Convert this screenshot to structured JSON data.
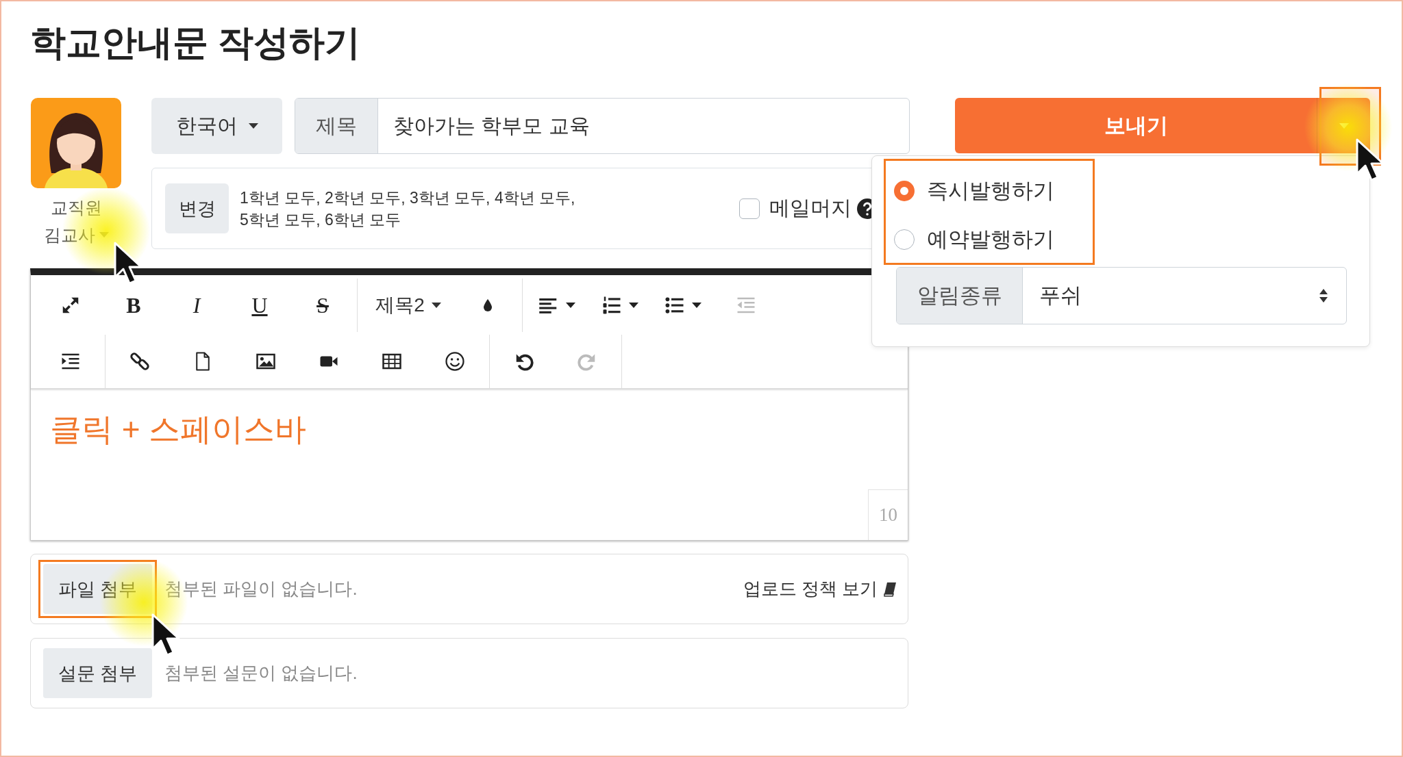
{
  "page_title": "학교안내문 작성하기",
  "author": {
    "role": "교직원",
    "name": "김교사",
    "pointer": true
  },
  "language": {
    "value": "한국어"
  },
  "subject": {
    "label": "제목",
    "value": "찾아가는 학부모 교육"
  },
  "recipients": {
    "button": "변경",
    "text": "1학년 모두, 2학년 모두, 3학년 모두, 4학년 모두,\n5학년 모두, 6학년 모두"
  },
  "mail_merge": {
    "label": "메일머지",
    "checked": false
  },
  "send": {
    "label": "보내기",
    "toggle_highlighted": true,
    "toggle_pointer": true
  },
  "send_menu": {
    "options_highlighted": true,
    "options": [
      {
        "label": "즉시발행하기",
        "selected": true
      },
      {
        "label": "예약발행하기",
        "selected": false
      }
    ],
    "notification_type": {
      "label": "알림종류",
      "value": "푸쉬"
    }
  },
  "editor": {
    "toolbar": [
      [
        [
          {
            "kind": "expand",
            "disabled": false
          },
          {
            "kind": "bold",
            "label": "B",
            "disabled": false
          },
          {
            "kind": "italic",
            "label": "I",
            "disabled": false
          },
          {
            "kind": "underline",
            "label": "U",
            "disabled": false
          },
          {
            "kind": "strike",
            "label": "S",
            "disabled": false
          }
        ],
        [
          {
            "kind": "heading",
            "label": "제목2",
            "disabled": false
          },
          {
            "kind": "color",
            "disabled": false
          }
        ],
        [
          {
            "kind": "align",
            "disabled": false
          },
          {
            "kind": "ordered-list",
            "disabled": false
          },
          {
            "kind": "bullet-list",
            "disabled": false
          },
          {
            "kind": "outdent",
            "disabled": true
          }
        ]
      ],
      [
        [
          {
            "kind": "indent",
            "disabled": false
          }
        ],
        [
          {
            "kind": "link",
            "disabled": false
          },
          {
            "kind": "file",
            "disabled": false
          },
          {
            "kind": "image",
            "disabled": false
          },
          {
            "kind": "video",
            "disabled": false
          },
          {
            "kind": "table",
            "disabled": false
          },
          {
            "kind": "emoji",
            "disabled": false
          }
        ],
        [
          {
            "kind": "undo",
            "disabled": false
          },
          {
            "kind": "redo",
            "disabled": true
          }
        ]
      ]
    ],
    "content": "클릭 + 스페이스바",
    "counter": "10"
  },
  "attachments": [
    {
      "button": "파일 첨부",
      "status": "첨부된 파일이 없습니다.",
      "link": "업로드 정책 보기",
      "highlighted": true,
      "pointer": true
    },
    {
      "button": "설문 첨부",
      "status": "첨부된 설문이 없습니다.",
      "highlighted": false,
      "pointer": false
    }
  ]
}
